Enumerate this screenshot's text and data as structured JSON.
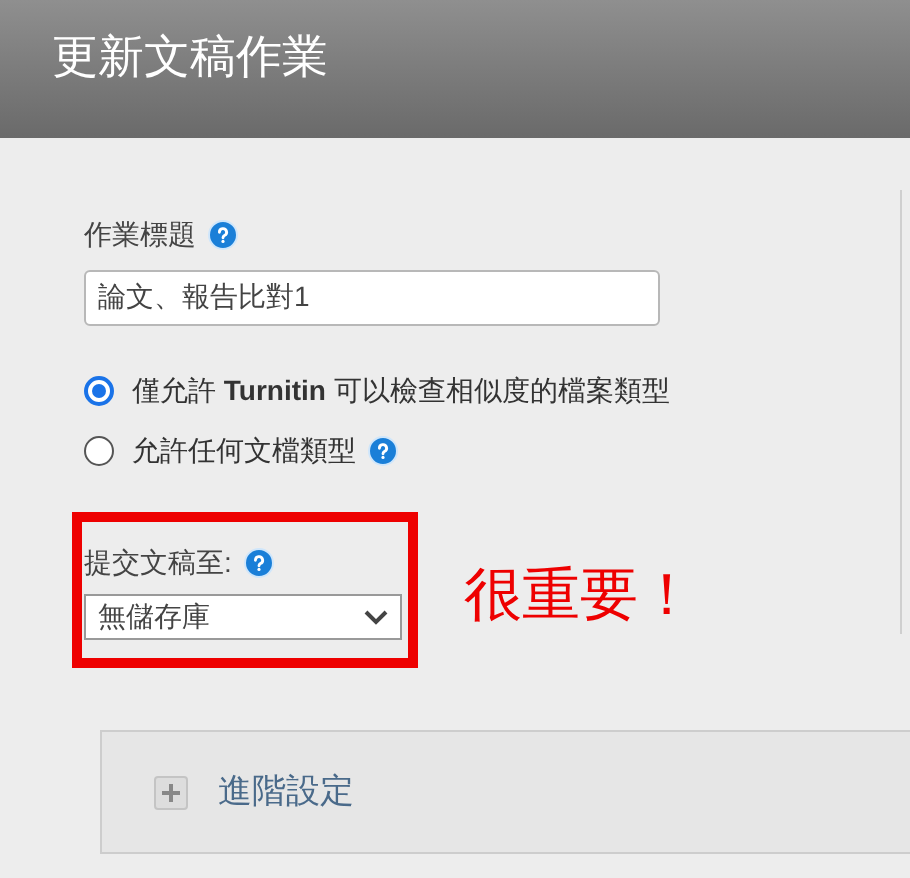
{
  "header": {
    "title": "更新文稿作業"
  },
  "assignment_title": {
    "label": "作業標題",
    "value": "論文、報告比對1"
  },
  "file_types": [
    {
      "label": "僅允許 **Turnitin** 可以檢查相似度的檔案類型",
      "selected": true,
      "help": false
    },
    {
      "label": "允許任何文檔類型",
      "selected": false,
      "help": true
    }
  ],
  "submit_to": {
    "label": "提交文稿至:",
    "value": "無儲存庫",
    "highlighted": true,
    "annotation": "很重要！"
  },
  "advanced": {
    "label": "進階設定",
    "expanded": false
  }
}
